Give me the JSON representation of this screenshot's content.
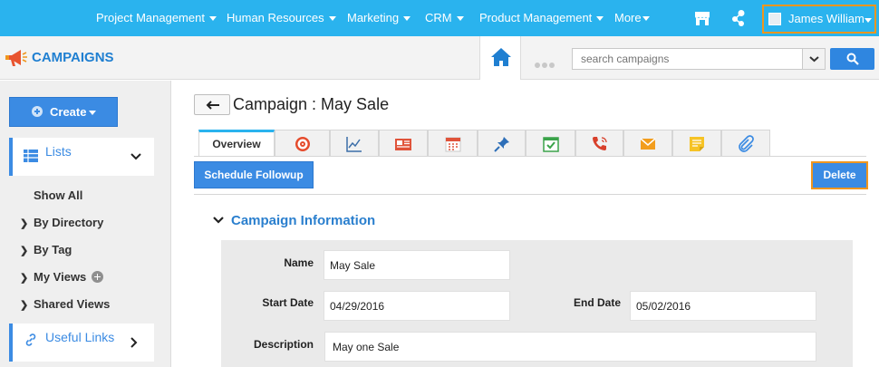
{
  "topnav": {
    "items": [
      {
        "label": "Project Management",
        "caret": true
      },
      {
        "label": "Human Resources",
        "caret": true
      },
      {
        "label": "Marketing",
        "caret": true
      },
      {
        "label": "CRM",
        "caret": true
      },
      {
        "label": "Product Management",
        "caret": true
      },
      {
        "label": "More",
        "caret": true
      }
    ],
    "user_name": "James William",
    "bg_color": "#2ab3ee",
    "highlight_color": "#f0961e"
  },
  "module": {
    "title": "CAMPAIGNS",
    "icon": "megaphone-icon"
  },
  "search": {
    "placeholder": "search campaigns"
  },
  "sidebar": {
    "create_label": "Create",
    "lists_label": "Lists",
    "links": [
      "Show All",
      "By Directory",
      "By Tag",
      "My Views",
      "Shared Views"
    ],
    "useful_links_label": "Useful Links"
  },
  "main": {
    "title": "Campaign : May Sale",
    "tabs": [
      {
        "label": "Overview",
        "icon": ""
      },
      {
        "label": "",
        "icon": "target-icon"
      },
      {
        "label": "",
        "icon": "line-chart-icon"
      },
      {
        "label": "",
        "icon": "newspaper-icon"
      },
      {
        "label": "",
        "icon": "calendar-icon"
      },
      {
        "label": "",
        "icon": "pin-icon"
      },
      {
        "label": "",
        "icon": "task-check-icon"
      },
      {
        "label": "",
        "icon": "phone-icon"
      },
      {
        "label": "",
        "icon": "email-icon"
      },
      {
        "label": "",
        "icon": "sticky-note-icon"
      },
      {
        "label": "",
        "icon": "paperclip-icon"
      }
    ],
    "schedule_followup_label": "Schedule Followup",
    "delete_label": "Delete",
    "section_title": "Campaign Information",
    "form": {
      "name_label": "Name",
      "name_value": "May Sale",
      "start_date_label": "Start Date",
      "start_date_value": "04/29/2016",
      "end_date_label": "End Date",
      "end_date_value": "05/02/2016",
      "description_label": "Description",
      "description_value": "May one Sale"
    }
  },
  "colors": {
    "accent": "#3b8be3",
    "link": "#2a7fce"
  }
}
